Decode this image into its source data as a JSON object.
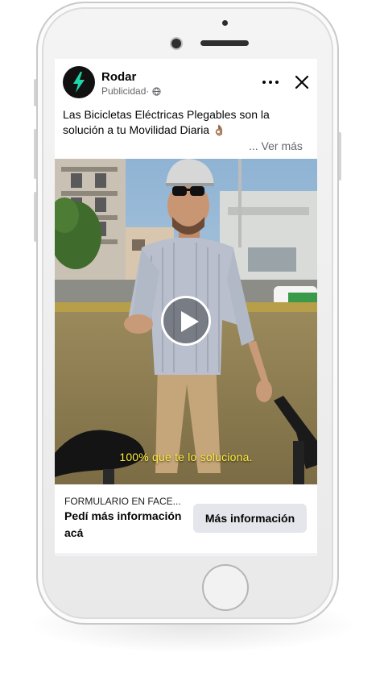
{
  "post": {
    "page_name": "Rodar",
    "sponsored_label": "Publicidad",
    "meta_separator": " · ",
    "caption": "Las Bicicletas Eléctricas Plegables son la solución a tu Movilidad Diaria",
    "caption_emoji": "👌🏽",
    "see_more": "... Ver más"
  },
  "video": {
    "subtitle": "100% que te lo soluciona."
  },
  "cta": {
    "source": "FORMULARIO EN FACE...",
    "title": "Pedí más información acá",
    "button_label": "Más información"
  },
  "icons": {
    "avatar": "lightning-bolt-icon",
    "audience": "globe-icon",
    "more": "more-dots-icon",
    "close": "close-icon",
    "play": "play-icon"
  },
  "colors": {
    "brand_bolt": "#1ed6a8",
    "subtitle": "#ffef3b",
    "cta_button_bg": "#e4e6eb"
  }
}
